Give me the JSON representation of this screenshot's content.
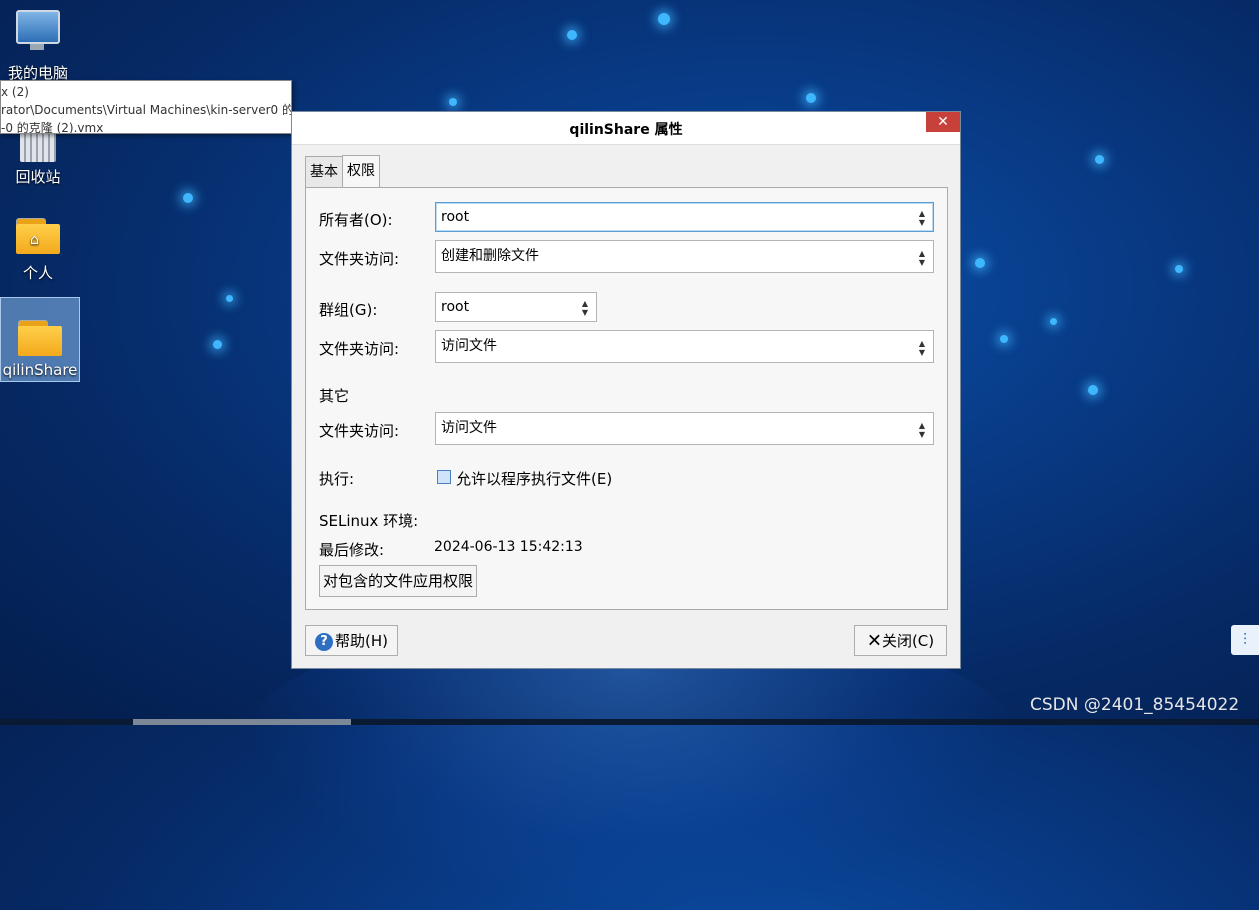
{
  "desktop": {
    "icons": [
      {
        "label": "我的电脑"
      },
      {
        "label": "回收站"
      },
      {
        "label": "个人"
      },
      {
        "label": "qilinShare"
      }
    ],
    "tooltip": {
      "line1": "x (2)",
      "line2": "rator\\Documents\\Virtual Machines\\kin-server0 的",
      "line3": "-0 的克隆 (2).vmx"
    },
    "watermark": "CSDN @2401_85454022"
  },
  "dialog": {
    "title": "qilinShare 属性",
    "close_glyph": "✕",
    "tabs": [
      {
        "label": "基本",
        "active": false
      },
      {
        "label": "权限",
        "active": true
      }
    ],
    "owner": {
      "label": "所有者(O):",
      "value": "root"
    },
    "owner_access": {
      "label": "文件夹访问:",
      "value": "创建和删除文件"
    },
    "group": {
      "label": "群组(G):",
      "value": "root"
    },
    "group_access": {
      "label": "文件夹访问:",
      "value": "访问文件"
    },
    "other": {
      "heading": "其它",
      "label": "文件夹访问:",
      "value": "访问文件"
    },
    "execute": {
      "label": "执行:",
      "checkbox_label": "允许以程序执行文件(E)",
      "checked": false
    },
    "selinux": {
      "label": "SELinux 环境:"
    },
    "modified": {
      "label": "最后修改:",
      "value": "2024-06-13 15:42:13"
    },
    "apply_button": "对包含的文件应用权限",
    "help_button": "帮助(H)",
    "close_button": "关闭(C)"
  },
  "colors": {
    "accent": "#5aa0d8",
    "close_red": "#c7403a",
    "desktop_blue": "#083a85"
  }
}
